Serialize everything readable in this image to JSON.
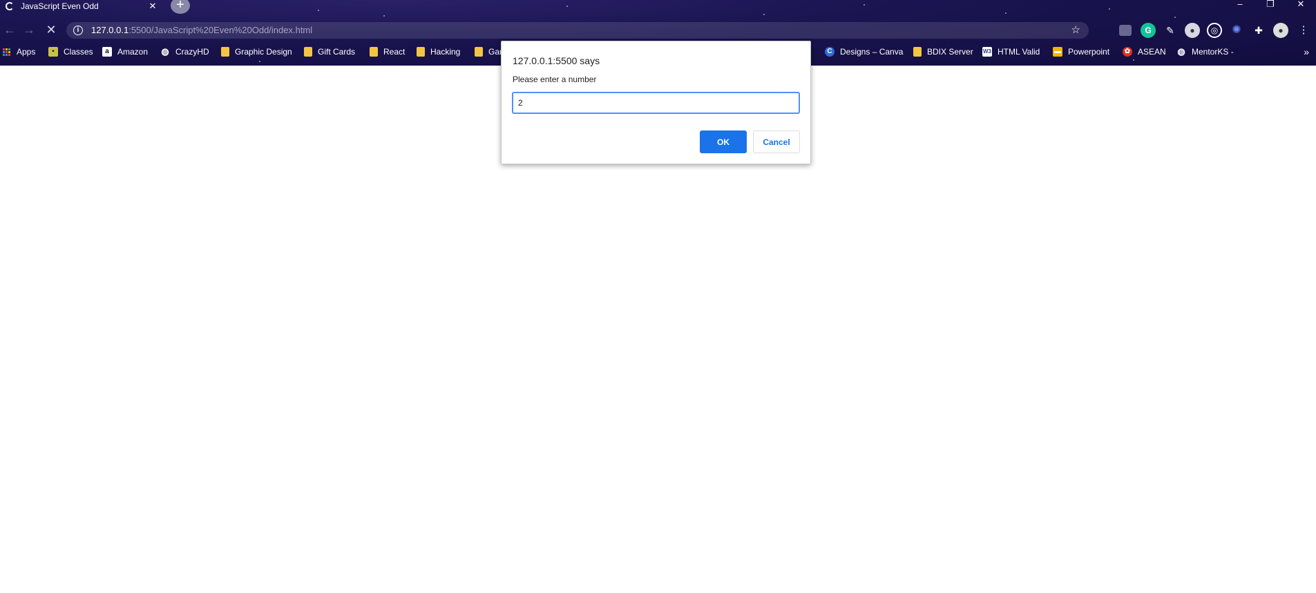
{
  "browser": {
    "tab": {
      "title": "JavaScript Even Odd",
      "close": "✕"
    },
    "new_tab": "+",
    "window_controls": {
      "minimize": "–",
      "restore": "❐",
      "close": "✕"
    },
    "address": {
      "host": "127.0.0.1",
      "path": ":5500/JavaScript%20Even%20Odd/index.html"
    },
    "bookmarks": [
      {
        "label": "Apps"
      },
      {
        "label": "Classes"
      },
      {
        "label": "Amazon"
      },
      {
        "label": "CrazyHD"
      },
      {
        "label": "Graphic Design"
      },
      {
        "label": "Gift Cards"
      },
      {
        "label": "React"
      },
      {
        "label": "Hacking"
      },
      {
        "label": "Gar"
      },
      {
        "label": "Designs – Canva"
      },
      {
        "label": "BDIX Server"
      },
      {
        "label": "HTML Valid"
      },
      {
        "label": "Powerpoint"
      },
      {
        "label": "ASEAN"
      },
      {
        "label": "MentorKS -"
      }
    ],
    "bookmark_overflow": "»"
  },
  "dialog": {
    "title": "127.0.0.1:5500 says",
    "message": "Please enter a number",
    "input_value": "2",
    "ok_label": "OK",
    "cancel_label": "Cancel"
  },
  "colors": {
    "chrome_bg": "#1a1450",
    "accent": "#1a73e8",
    "folder": "#f4c542"
  }
}
